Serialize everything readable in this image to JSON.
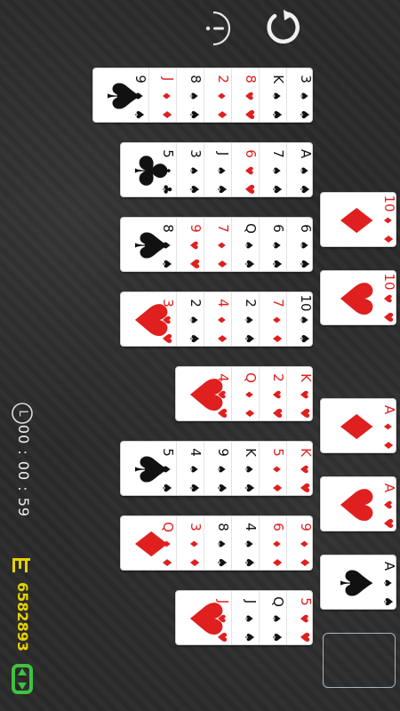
{
  "toolbar": {
    "info_icon": "info-icon",
    "restart_icon": "restart-icon"
  },
  "status": {
    "level_icon": "level-icon",
    "level_label": "L",
    "timer": "00 : 00 : 59",
    "flag_icon": "flag-icon",
    "score": "6582893",
    "recycle_icon": "recycle-icon"
  },
  "colors": {
    "red": "#e01f1f",
    "black": "#111111",
    "score": "#e6d200",
    "recycle": "#3fc23f"
  },
  "tableau": [
    {
      "name": "column-1",
      "cards": [
        [
          "3",
          "spade"
        ],
        [
          "K",
          "spade"
        ],
        [
          "8",
          "heart"
        ],
        [
          "2",
          "diamond"
        ],
        [
          "8",
          "spade"
        ],
        [
          "J",
          "diamond"
        ],
        [
          "9",
          "spade"
        ]
      ]
    },
    {
      "name": "column-2",
      "cards": [
        [
          "A",
          "spade"
        ],
        [
          "7",
          "spade"
        ],
        [
          "6",
          "heart"
        ],
        [
          "J",
          "spade"
        ],
        [
          "3",
          "spade"
        ],
        [
          "5",
          "club"
        ]
      ]
    },
    {
      "name": "column-3",
      "cards": [
        [
          "6",
          "spade"
        ],
        [
          "6",
          "spade"
        ],
        [
          "Q",
          "spade"
        ],
        [
          "7",
          "diamond"
        ],
        [
          "9",
          "heart"
        ],
        [
          "8",
          "spade"
        ]
      ]
    },
    {
      "name": "column-4",
      "cards": [
        [
          "10",
          "spade"
        ],
        [
          "7",
          "diamond"
        ],
        [
          "2",
          "spade"
        ],
        [
          "4",
          "diamond"
        ],
        [
          "2",
          "spade"
        ],
        [
          "3",
          "heart"
        ]
      ]
    },
    {
      "name": "column-5",
      "cards": [
        [
          "K",
          "heart"
        ],
        [
          "2",
          "heart"
        ],
        [
          "Q",
          "diamond"
        ],
        [
          "4",
          "heart"
        ]
      ]
    },
    {
      "name": "column-6",
      "cards": [
        [
          "K",
          "heart"
        ],
        [
          "5",
          "diamond"
        ],
        [
          "K",
          "spade"
        ],
        [
          "9",
          "spade"
        ],
        [
          "4",
          "spade"
        ],
        [
          "5",
          "spade"
        ]
      ]
    },
    {
      "name": "column-7",
      "cards": [
        [
          "9",
          "diamond"
        ],
        [
          "6",
          "diamond"
        ],
        [
          "4",
          "spade"
        ],
        [
          "8",
          "spade"
        ],
        [
          "3",
          "diamond"
        ],
        [
          "Q",
          "diamond"
        ]
      ]
    },
    {
      "name": "column-8",
      "cards": [
        [
          "5",
          "heart"
        ],
        [
          "Q",
          "spade"
        ],
        [
          "J",
          "spade"
        ],
        [
          "J",
          "heart"
        ]
      ]
    }
  ],
  "foundations": [
    {
      "name": "foundation-10-diamond",
      "rank": "10",
      "suit": "diamond"
    },
    {
      "name": "foundation-10-heart",
      "rank": "10",
      "suit": "heart"
    },
    {
      "name": "foundation-A-diamond",
      "rank": "A",
      "suit": "diamond"
    },
    {
      "name": "foundation-A-heart",
      "rank": "A",
      "suit": "heart"
    },
    {
      "name": "foundation-A-spade",
      "rank": "A",
      "suit": "spade"
    }
  ]
}
